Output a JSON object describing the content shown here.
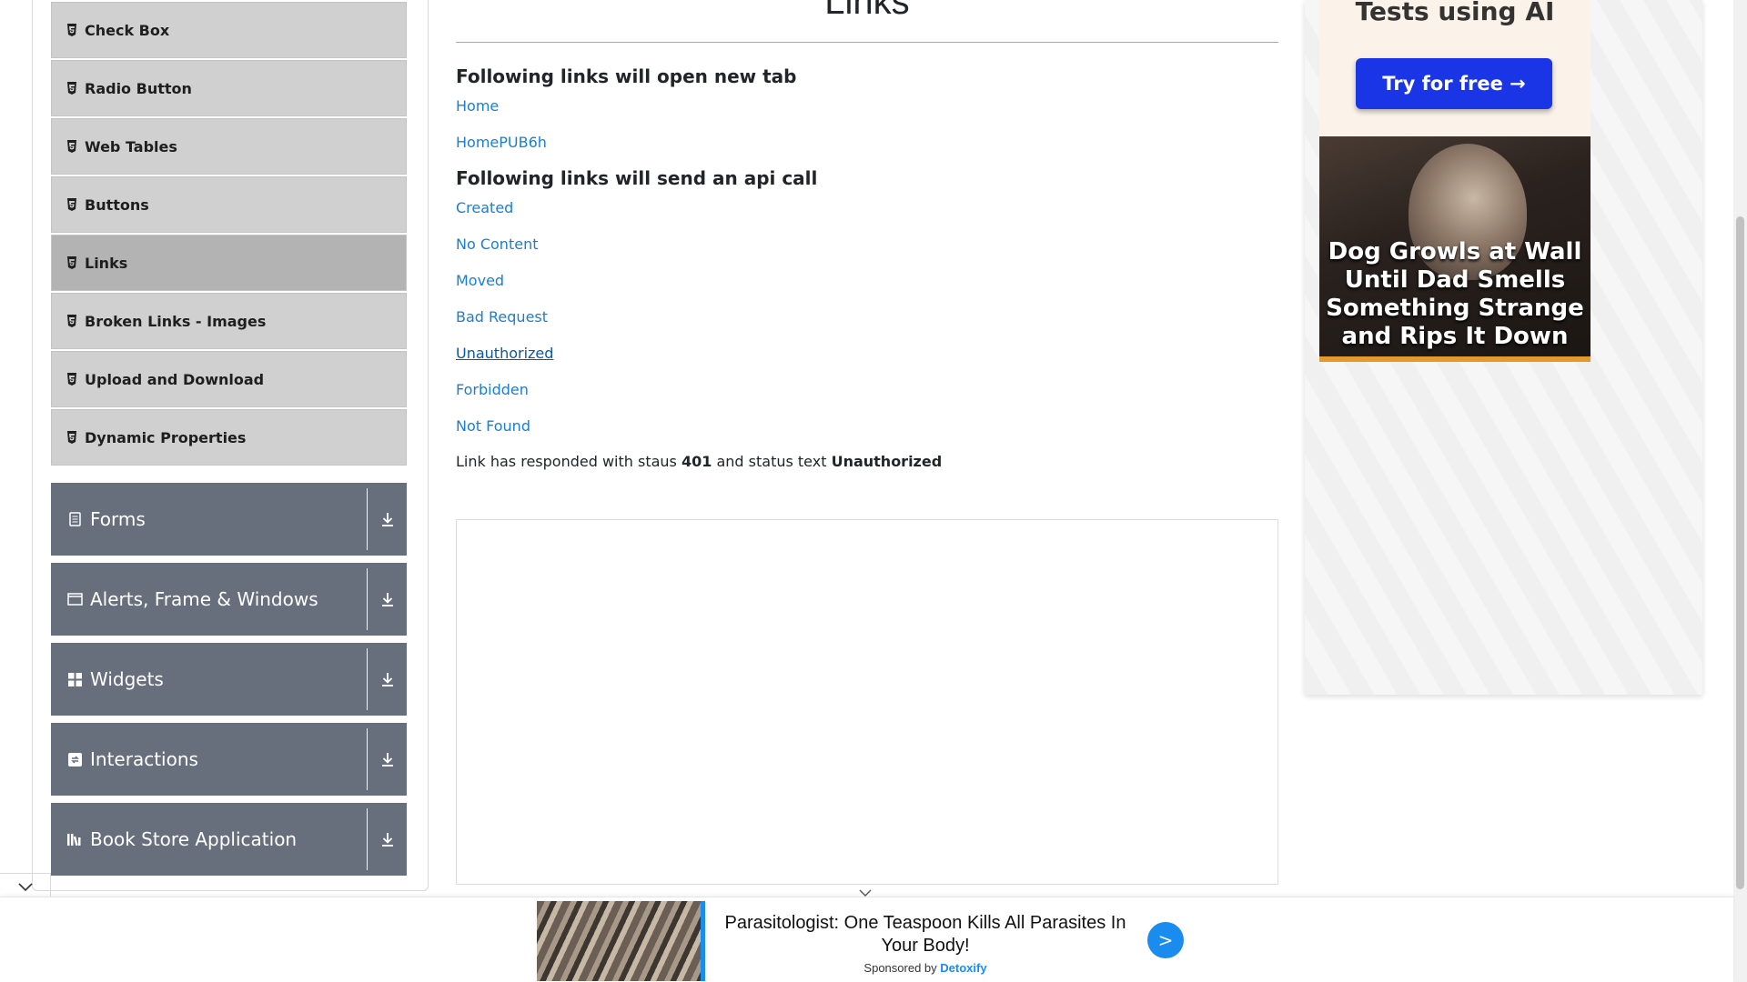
{
  "sidebar": {
    "elements_items": [
      {
        "label": "Check Box"
      },
      {
        "label": "Radio Button"
      },
      {
        "label": "Web Tables"
      },
      {
        "label": "Buttons"
      },
      {
        "label": "Links",
        "active": true
      },
      {
        "label": "Broken Links - Images"
      },
      {
        "label": "Upload and Download"
      },
      {
        "label": "Dynamic Properties"
      }
    ],
    "groups": [
      {
        "label": "Forms",
        "icon": "form-icon"
      },
      {
        "label": "Alerts, Frame & Windows",
        "icon": "window-icon"
      },
      {
        "label": "Widgets",
        "icon": "widgets-icon"
      },
      {
        "label": "Interactions",
        "icon": "interactions-icon"
      },
      {
        "label": "Book Store Application",
        "icon": "book-icon"
      }
    ]
  },
  "main": {
    "title": "Links",
    "new_tab_heading": "Following links will open new tab",
    "new_tab_links": [
      "Home",
      "HomePUB6h"
    ],
    "api_heading": "Following links will send an api call",
    "api_links": [
      "Created",
      "No Content",
      "Moved",
      "Bad Request",
      "Unauthorized",
      "Forbidden",
      "Not Found"
    ],
    "focused_link": "Unauthorized",
    "response": {
      "prefix": "Link has responded with staus",
      "status_code": "401",
      "middle": "and status text",
      "status_text": "Unauthorized"
    }
  },
  "right_ad": {
    "top_text": "Tests using AI",
    "button": "Try for free →",
    "image_caption": "Dog Growls at Wall Until Dad Smells Something Strange and Rips It Down"
  },
  "bottom_ad": {
    "headline": "Parasitologist: One Teaspoon Kills All Parasites In Your Body!",
    "sponsored_prefix": "Sponsored by",
    "sponsor": "Detoxify",
    "button": ">"
  },
  "colors": {
    "link": "#1a7fd4",
    "group_bg": "#676e7c",
    "submenu_bg": "#d0d0d0",
    "submenu_active_bg": "#b3b3b3",
    "ad_button": "#1a35e6"
  }
}
